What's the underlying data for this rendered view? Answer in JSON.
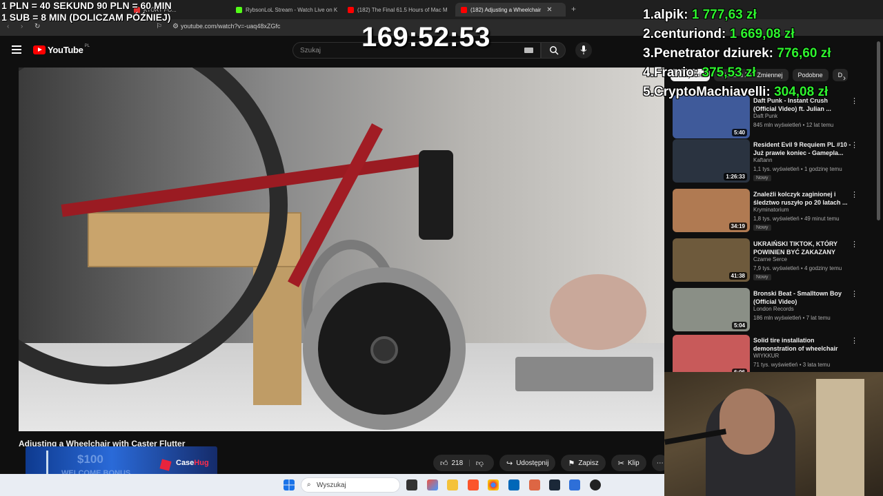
{
  "browser": {
    "tabs": [
      {
        "label": "KTÓRY PO...",
        "color": "#e03030"
      },
      {
        "label": "RybsonLoL Stream - Watch Live on K",
        "color": "#53fc18"
      },
      {
        "label": "(182) The Final 61.5 Hours of Mac M",
        "color": "#ff0000"
      },
      {
        "label": "(182) Adjusting a Wheelchair",
        "color": "#ff0000"
      }
    ],
    "url": "youtube.com/watch?v=-uaq48xZGfc"
  },
  "stream_overlay": {
    "rules_line1": "1 PLN = 40 SEKUND 90 PLN = 60 MIN",
    "rules_line2": "1 SUB = 8 MIN (DOLICZAM PÓŹNIEJ)",
    "timer": "169:52:53",
    "leaderboard": [
      {
        "rank": "1.",
        "name": "alpik:",
        "amount": "1 777,63 zł"
      },
      {
        "rank": "2.",
        "name": "centuriond:",
        "amount": "1 669,08 zł"
      },
      {
        "rank": "3.",
        "name": "Penetrator dziurek:",
        "amount": "776,60 zł"
      },
      {
        "rank": "4.",
        "name": "Franio:",
        "amount": "375,53 zł"
      },
      {
        "rank": "5.",
        "name": "CryptoMachiavelli:",
        "amount": "304,08 zł"
      }
    ]
  },
  "youtube": {
    "logo": "YouTube",
    "country": "PL",
    "search_placeholder": "Szukaj",
    "video_title": "Adjusting a Wheelchair with Caster Flutter",
    "actions": {
      "likes": "218",
      "share": "Udostępnij",
      "save": "Zapisz",
      "clip": "Klip"
    },
    "chips": [
      "Wszystkie",
      "Z kanału Zoo Zmiennej",
      "Podobne",
      "D"
    ],
    "recommendations": [
      {
        "title": "Daft Punk - Instant Crush (Official Video) ft. Julian ...",
        "channel": "Daft Punk",
        "meta": "845 mln wyświetleń • 12 lat temu",
        "duration": "5:40",
        "badge": "",
        "thumb": "#3f5a9a"
      },
      {
        "title": "Resident Evil 9 Requiem PL #10 - Już prawie koniec - Gamepla...",
        "channel": "Kaftann",
        "meta": "1,1 tys. wyświetleń • 1 godzinę temu",
        "duration": "1:26:33",
        "badge": "Nowy",
        "thumb": "#2a3340"
      },
      {
        "title": "Znaleźli kolczyk zaginionej i śledztwo ruszyło po 20 latach ...",
        "channel": "Kryminatorium",
        "meta": "1,8 tys. wyświetleń • 49 minut temu",
        "duration": "34:19",
        "badge": "Nowy",
        "thumb": "#b07a52"
      },
      {
        "title": "UKRAIŃSKI TIKTOK, KTÓRY POWINIEN BYĆ ZAKAZANY",
        "channel": "Czarne Serce",
        "meta": "7,9 tys. wyświetleń • 4 godziny temu",
        "duration": "41:38",
        "badge": "Nowy",
        "thumb": "#6e5a3c"
      },
      {
        "title": "Bronski Beat - Smalltown Boy (Official Video)",
        "channel": "London Records",
        "meta": "186 mln wyświetleń • 7 lat temu",
        "duration": "5:04",
        "badge": "",
        "thumb": "#8a8f86"
      },
      {
        "title": "Solid tire installation demonstration of wheelchair",
        "channel": "WIYKKUR",
        "meta": "71 tys. wyświetleń • 3 lata temu",
        "duration": "6:06",
        "badge": "",
        "thumb": "#c85a5a"
      }
    ]
  },
  "promo": {
    "big": "$100",
    "small": "WELCOME BONUS",
    "brand_a": "Case",
    "brand_b": "Hug"
  },
  "taskbar": {
    "search": "Wyszukaj"
  }
}
